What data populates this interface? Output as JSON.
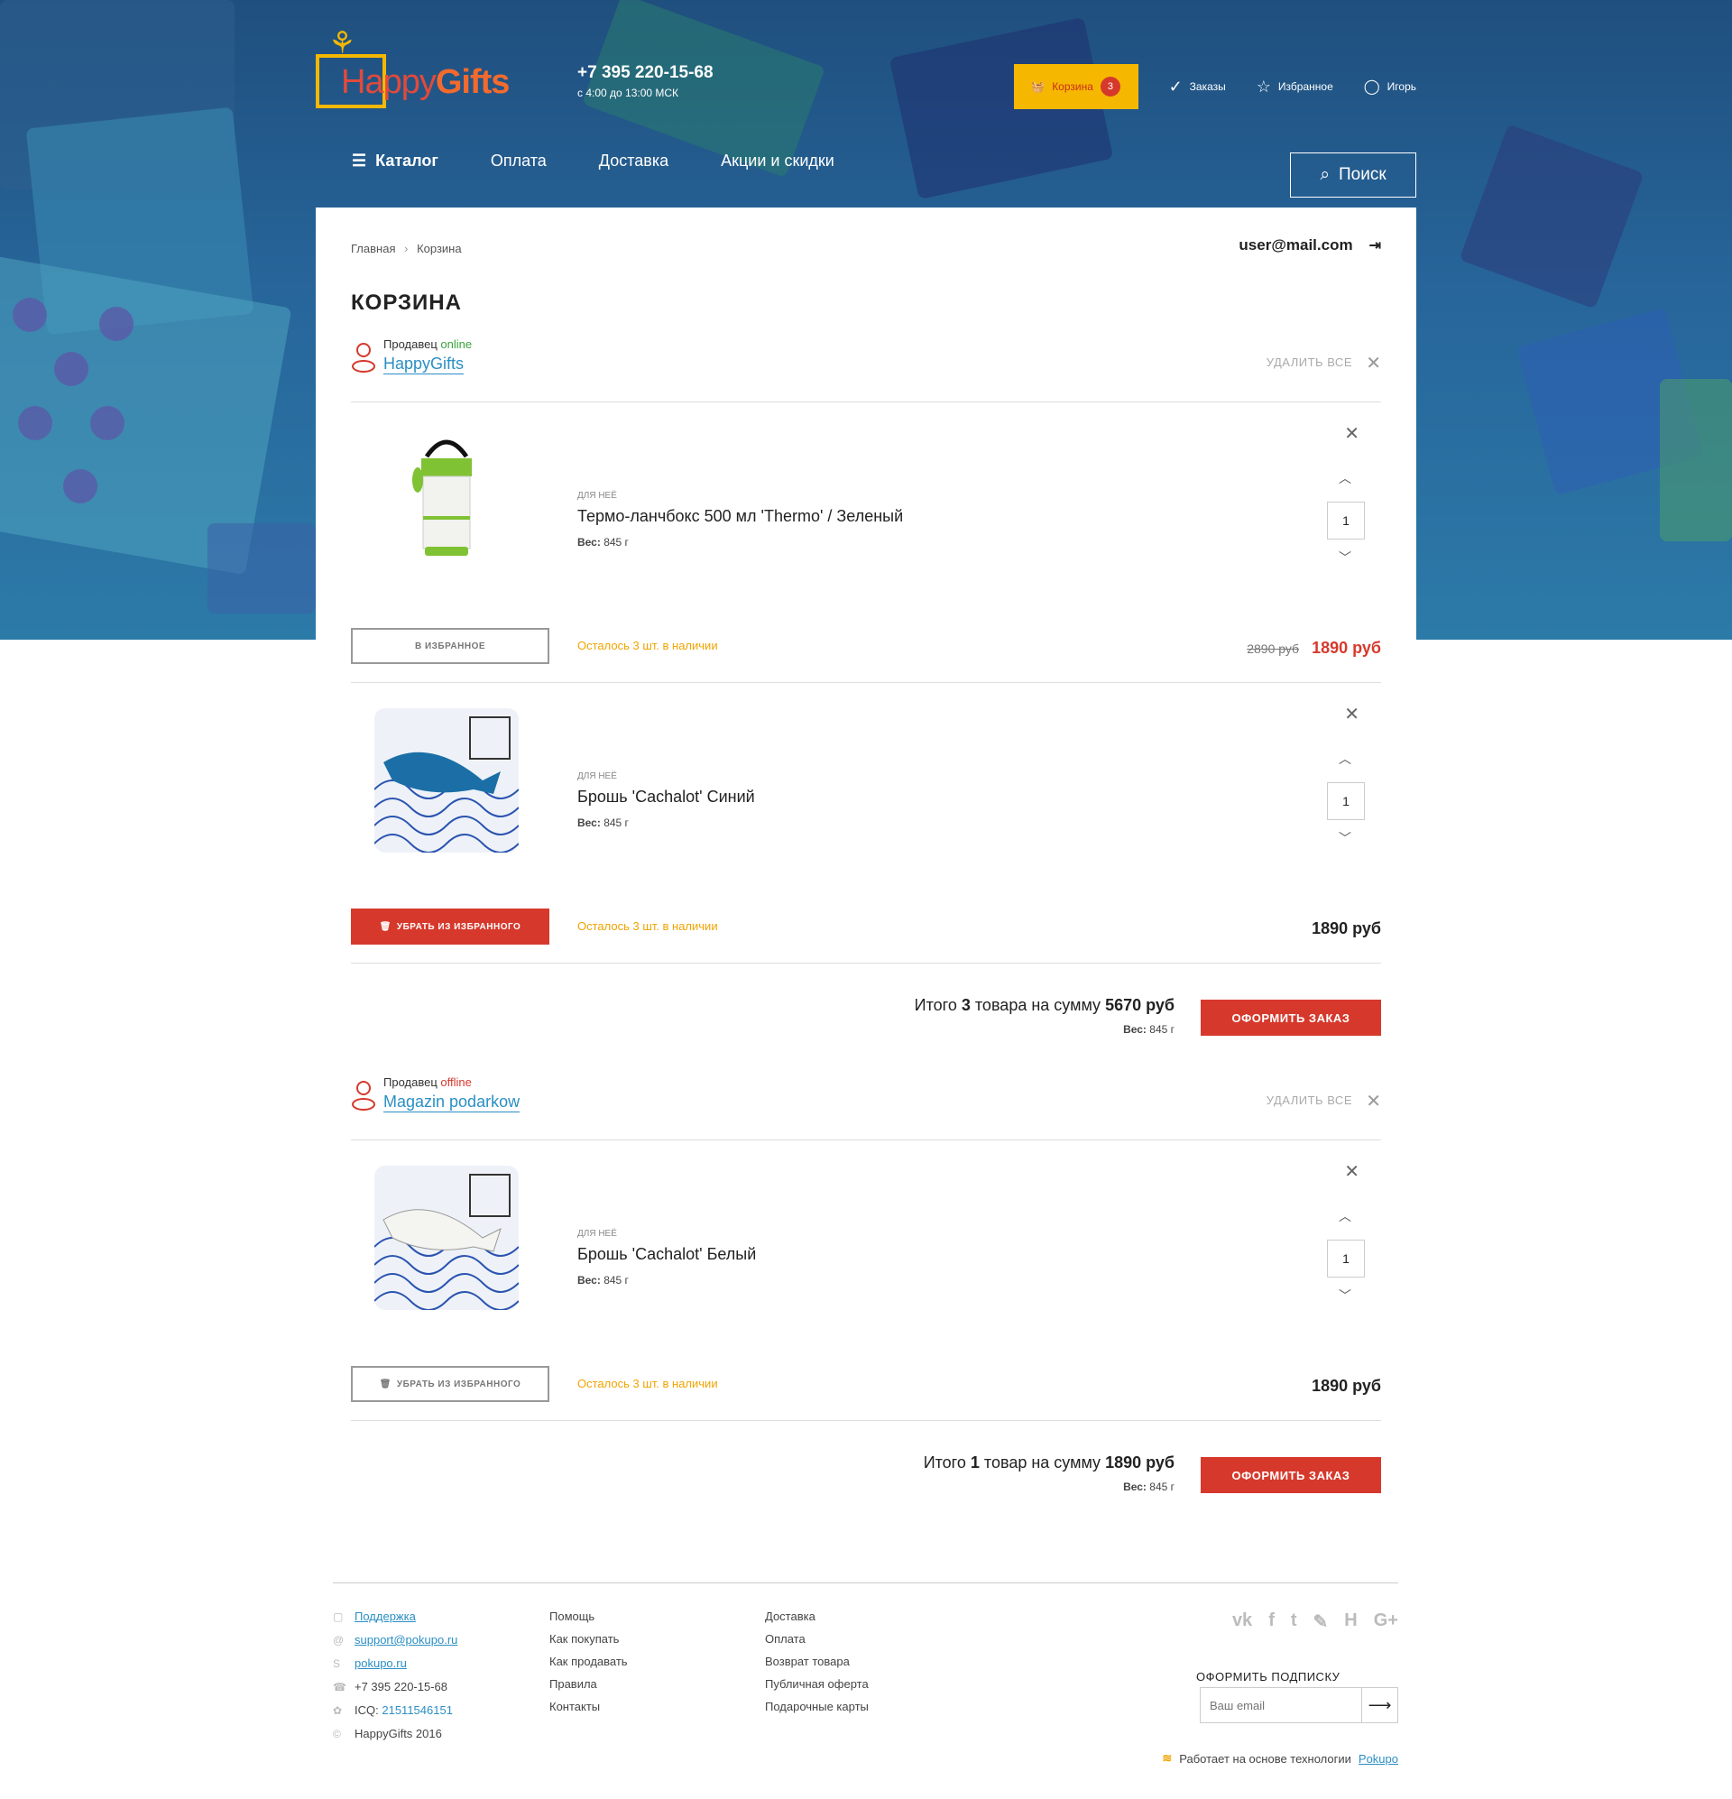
{
  "brand": {
    "logo_part1": "Happy",
    "logo_part2": "Gifts",
    "phone": "+7 395 220-15-68",
    "hours": "с 4:00 до 13:00 МСК"
  },
  "topnav": {
    "cart_label": "Корзина",
    "cart_count": "3",
    "orders": "Заказы",
    "favorites": "Избранное",
    "user": "Игорь"
  },
  "menu": {
    "catalog": "Каталог",
    "items": [
      "Оплата",
      "Доставка",
      "Акции и скидки"
    ],
    "search": "Поиск"
  },
  "breadcrumb": {
    "home": "Главная",
    "sep": "›",
    "current": "Корзина"
  },
  "account": {
    "email": "user@mail.com"
  },
  "page_title": "КОРЗИНА",
  "sellers": [
    {
      "label": "Продавец",
      "status": "online",
      "status_color": "#3aa33a",
      "name": "HappyGifts",
      "delete_all": "УДАЛИТЬ ВСЕ",
      "items": [
        {
          "category": "ДЛЯ НЕЁ",
          "name": "Термо-ланчбокс 500 мл 'Thermo' / Зеленый",
          "weight_label": "Вес:",
          "weight": "845 г",
          "qty": "1",
          "fav_button": "В ИЗБРАННОЕ",
          "stock": "Осталось 3 шт. в наличии",
          "old_price": "2890 руб",
          "price": "1890 руб"
        },
        {
          "category": "ДЛЯ НЕЁ",
          "name": "Брошь 'Cachalot' Синий",
          "weight_label": "Вес:",
          "weight": "845 г",
          "qty": "1",
          "fav_button": "УБРАТЬ ИЗ ИЗБРАННОГО",
          "stock": "Осталось 3 шт. в наличии",
          "price": "1890 руб"
        }
      ],
      "total": {
        "prefix": "Итого",
        "count": "3",
        "mid": "товара на сумму",
        "sum": "5670 руб",
        "weight_label": "Вес:",
        "weight": "845 г",
        "order_button": "ОФОРМИТЬ ЗАКАЗ"
      }
    },
    {
      "label": "Продавец",
      "status": "offline",
      "status_color": "#d6392c",
      "name": "Magazin podarkow",
      "delete_all": "УДАЛИТЬ ВСЕ",
      "items": [
        {
          "category": "ДЛЯ НЕЁ",
          "name": "Брошь 'Cachalot' Белый",
          "weight_label": "Вес:",
          "weight": "845 г",
          "qty": "1",
          "fav_button": "УБРАТЬ ИЗ ИЗБРАННОГО",
          "stock": "Осталось 3 шт. в наличии",
          "price": "1890 руб"
        }
      ],
      "total": {
        "prefix": "Итого",
        "count": "1",
        "mid": "товар на сумму",
        "sum": "1890 руб",
        "weight_label": "Вес:",
        "weight": "845 г",
        "order_button": "ОФОРМИТЬ ЗАКАЗ"
      }
    }
  ],
  "footer": {
    "col1": [
      {
        "icon": "support-icon",
        "text": "Поддержка",
        "link": true
      },
      {
        "icon": "at-icon",
        "text": "support@pokupo.ru",
        "link": true
      },
      {
        "icon": "skype-icon",
        "text": "pokupo.ru",
        "link": true
      },
      {
        "icon": "phone-icon",
        "text": "+7 395 220-15-68",
        "link": false
      },
      {
        "icon": "icq-icon",
        "text": "ICQ:",
        "extra": "21511546151"
      },
      {
        "icon": "copyright-icon",
        "text": "HappyGifts 2016",
        "link": false
      }
    ],
    "col2": [
      "Помощь",
      "Как покупать",
      "Как продавать",
      "Правила",
      "Контакты"
    ],
    "col3": [
      "Доставка",
      "Оплата",
      "Возврат товара",
      "Публичная оферта",
      "Подарочные карты"
    ],
    "social": [
      "vk-icon",
      "facebook-icon",
      "twitter-icon",
      "livejournal-icon",
      "habr-icon",
      "googleplus-icon"
    ],
    "subscribe_title": "ОФОРМИТЬ ПОДПИСКУ",
    "subscribe_placeholder": "Ваш email",
    "powered_text": "Работает на основе технологии",
    "powered_link": "Pokupo"
  },
  "colors": {
    "accent": "#d6392c",
    "cart_bg": "#f6b700",
    "link": "#2b8fc4",
    "stock": "#f0a400"
  }
}
